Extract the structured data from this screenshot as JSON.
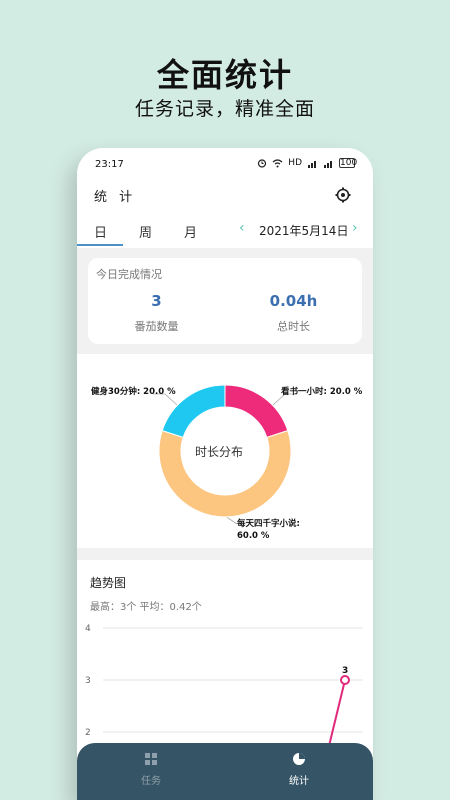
{
  "promo": {
    "title": "全面统计",
    "subtitle": "任务记录，精准全面"
  },
  "status_bar": {
    "time": "23:17",
    "icons": [
      "alarm-icon",
      "wifi-icon",
      "hd-icon",
      "signal-icon",
      "signal-icon",
      "battery-icon"
    ],
    "hd_text": "HD",
    "battery_text": "100"
  },
  "app_bar": {
    "title": "统 计",
    "settings_icon": "gear-icon"
  },
  "tabs": {
    "day": "日",
    "week": "周",
    "month": "月",
    "active": "day"
  },
  "date_nav": {
    "date": "2021年5月14日"
  },
  "summary": {
    "title": "今日完成情况",
    "count_value": "3",
    "count_label": "番茄数量",
    "time_value": "0.04h",
    "time_label": "总时长"
  },
  "distribution": {
    "center_label": "时长分布",
    "labels": [
      "健身30分钟: 20.0 %",
      "看书一小时: 20.0 %",
      "每天四千字小说:",
      "60.0 %"
    ],
    "slices": [
      {
        "name": "看书一小时",
        "percent": 20.0,
        "color": "#ee2a7b"
      },
      {
        "name": "每天四千字小说",
        "percent": 60.0,
        "color": "#fdc680"
      },
      {
        "name": "健身30分钟",
        "percent": 20.0,
        "color": "#1ec8f0"
      }
    ]
  },
  "trend": {
    "title": "趋势图",
    "subtitle": "最高：3个  平均：0.42个",
    "point_label": "3"
  },
  "chart_data": {
    "type": "line",
    "y_ticks": [
      "4",
      "3",
      "2"
    ],
    "ylim": [
      2,
      4
    ],
    "series": [
      {
        "values": [
          2,
          3
        ],
        "color": "#e0297a"
      }
    ],
    "data_labels": [
      "3"
    ]
  },
  "bottom_nav": {
    "task_label": "任务",
    "stats_label": "统计",
    "active": "stats"
  }
}
